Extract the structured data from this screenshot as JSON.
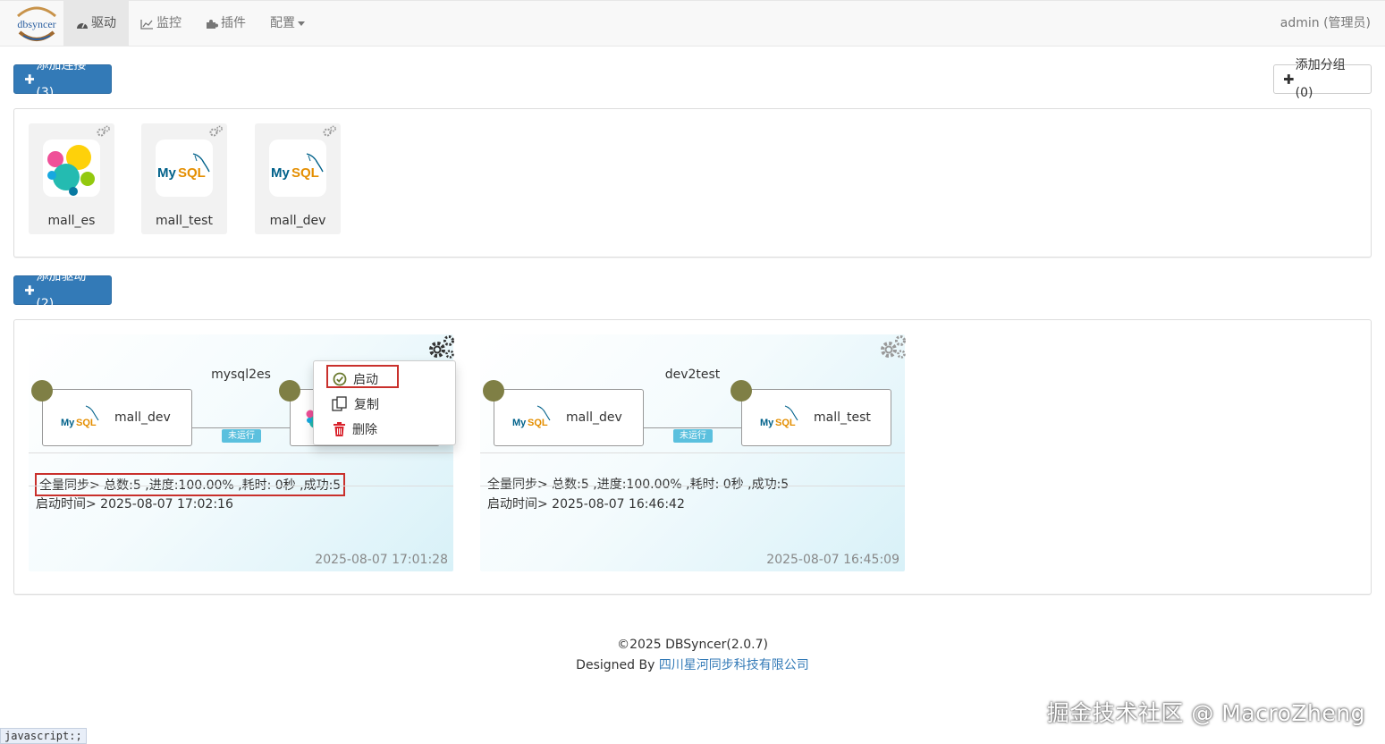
{
  "brand": {
    "text": "dbsyncer"
  },
  "nav": [
    {
      "label": "驱动",
      "icon": "dashboard-icon",
      "active": true
    },
    {
      "label": "监控",
      "icon": "chart-icon"
    },
    {
      "label": "插件",
      "icon": "plugin-icon"
    },
    {
      "label": "配置",
      "icon": "caret-down-icon"
    }
  ],
  "user": {
    "label": "admin (管理员)"
  },
  "buttons": {
    "add_connection": "添加连接(3)",
    "add_group": "添加分组(0)",
    "add_driver": "添加驱动(2)"
  },
  "connections": [
    {
      "name": "mall_es",
      "type": "elasticsearch-logo"
    },
    {
      "name": "mall_test",
      "type": "mysql-logo"
    },
    {
      "name": "mall_dev",
      "type": "mysql-logo"
    }
  ],
  "drivers": [
    {
      "title": "mysql2es",
      "source": "mall_dev",
      "target": "",
      "status": "未运行",
      "sync": "全量同步> 总数:5 ,进度:100.00% ,耗时: 0秒 ,成功:5",
      "start_time": "启动时间> 2025-08-07 17:02:16",
      "updated": "2025-08-07 17:01:28"
    },
    {
      "title": "dev2test",
      "source": "mall_dev",
      "target": "mall_test",
      "status": "未运行",
      "sync": "全量同步> 总数:5 ,进度:100.00% ,耗时: 0秒 ,成功:5",
      "start_time": "启动时间> 2025-08-07 16:46:42",
      "updated": "2025-08-07 16:45:09"
    }
  ],
  "context_menu": {
    "start": "启动",
    "copy": "复制",
    "delete": "删除"
  },
  "footer": {
    "copyright": "©2025 DBSyncer(2.0.7)",
    "designed_by": "Designed By",
    "company": "四川星河同步科技有限公司"
  },
  "statusbar": "javascript:;",
  "watermark": "掘金技术社区 @ MacroZheng",
  "colors": {
    "primary": "#337ab7",
    "dot": "#7f7f45",
    "badge": "#5bc0de",
    "highlight": "#c9302c"
  }
}
